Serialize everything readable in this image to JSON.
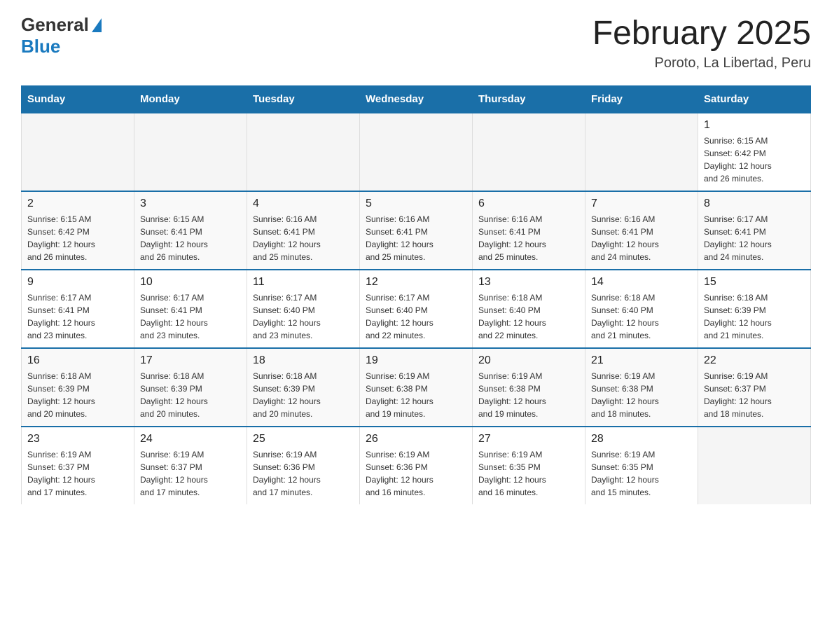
{
  "header": {
    "logo_general": "General",
    "logo_blue": "Blue",
    "month_title": "February 2025",
    "location": "Poroto, La Libertad, Peru"
  },
  "weekdays": [
    "Sunday",
    "Monday",
    "Tuesday",
    "Wednesday",
    "Thursday",
    "Friday",
    "Saturday"
  ],
  "weeks": [
    [
      {
        "day": "",
        "info": ""
      },
      {
        "day": "",
        "info": ""
      },
      {
        "day": "",
        "info": ""
      },
      {
        "day": "",
        "info": ""
      },
      {
        "day": "",
        "info": ""
      },
      {
        "day": "",
        "info": ""
      },
      {
        "day": "1",
        "info": "Sunrise: 6:15 AM\nSunset: 6:42 PM\nDaylight: 12 hours\nand 26 minutes."
      }
    ],
    [
      {
        "day": "2",
        "info": "Sunrise: 6:15 AM\nSunset: 6:42 PM\nDaylight: 12 hours\nand 26 minutes."
      },
      {
        "day": "3",
        "info": "Sunrise: 6:15 AM\nSunset: 6:41 PM\nDaylight: 12 hours\nand 26 minutes."
      },
      {
        "day": "4",
        "info": "Sunrise: 6:16 AM\nSunset: 6:41 PM\nDaylight: 12 hours\nand 25 minutes."
      },
      {
        "day": "5",
        "info": "Sunrise: 6:16 AM\nSunset: 6:41 PM\nDaylight: 12 hours\nand 25 minutes."
      },
      {
        "day": "6",
        "info": "Sunrise: 6:16 AM\nSunset: 6:41 PM\nDaylight: 12 hours\nand 25 minutes."
      },
      {
        "day": "7",
        "info": "Sunrise: 6:16 AM\nSunset: 6:41 PM\nDaylight: 12 hours\nand 24 minutes."
      },
      {
        "day": "8",
        "info": "Sunrise: 6:17 AM\nSunset: 6:41 PM\nDaylight: 12 hours\nand 24 minutes."
      }
    ],
    [
      {
        "day": "9",
        "info": "Sunrise: 6:17 AM\nSunset: 6:41 PM\nDaylight: 12 hours\nand 23 minutes."
      },
      {
        "day": "10",
        "info": "Sunrise: 6:17 AM\nSunset: 6:41 PM\nDaylight: 12 hours\nand 23 minutes."
      },
      {
        "day": "11",
        "info": "Sunrise: 6:17 AM\nSunset: 6:40 PM\nDaylight: 12 hours\nand 23 minutes."
      },
      {
        "day": "12",
        "info": "Sunrise: 6:17 AM\nSunset: 6:40 PM\nDaylight: 12 hours\nand 22 minutes."
      },
      {
        "day": "13",
        "info": "Sunrise: 6:18 AM\nSunset: 6:40 PM\nDaylight: 12 hours\nand 22 minutes."
      },
      {
        "day": "14",
        "info": "Sunrise: 6:18 AM\nSunset: 6:40 PM\nDaylight: 12 hours\nand 21 minutes."
      },
      {
        "day": "15",
        "info": "Sunrise: 6:18 AM\nSunset: 6:39 PM\nDaylight: 12 hours\nand 21 minutes."
      }
    ],
    [
      {
        "day": "16",
        "info": "Sunrise: 6:18 AM\nSunset: 6:39 PM\nDaylight: 12 hours\nand 20 minutes."
      },
      {
        "day": "17",
        "info": "Sunrise: 6:18 AM\nSunset: 6:39 PM\nDaylight: 12 hours\nand 20 minutes."
      },
      {
        "day": "18",
        "info": "Sunrise: 6:18 AM\nSunset: 6:39 PM\nDaylight: 12 hours\nand 20 minutes."
      },
      {
        "day": "19",
        "info": "Sunrise: 6:19 AM\nSunset: 6:38 PM\nDaylight: 12 hours\nand 19 minutes."
      },
      {
        "day": "20",
        "info": "Sunrise: 6:19 AM\nSunset: 6:38 PM\nDaylight: 12 hours\nand 19 minutes."
      },
      {
        "day": "21",
        "info": "Sunrise: 6:19 AM\nSunset: 6:38 PM\nDaylight: 12 hours\nand 18 minutes."
      },
      {
        "day": "22",
        "info": "Sunrise: 6:19 AM\nSunset: 6:37 PM\nDaylight: 12 hours\nand 18 minutes."
      }
    ],
    [
      {
        "day": "23",
        "info": "Sunrise: 6:19 AM\nSunset: 6:37 PM\nDaylight: 12 hours\nand 17 minutes."
      },
      {
        "day": "24",
        "info": "Sunrise: 6:19 AM\nSunset: 6:37 PM\nDaylight: 12 hours\nand 17 minutes."
      },
      {
        "day": "25",
        "info": "Sunrise: 6:19 AM\nSunset: 6:36 PM\nDaylight: 12 hours\nand 17 minutes."
      },
      {
        "day": "26",
        "info": "Sunrise: 6:19 AM\nSunset: 6:36 PM\nDaylight: 12 hours\nand 16 minutes."
      },
      {
        "day": "27",
        "info": "Sunrise: 6:19 AM\nSunset: 6:35 PM\nDaylight: 12 hours\nand 16 minutes."
      },
      {
        "day": "28",
        "info": "Sunrise: 6:19 AM\nSunset: 6:35 PM\nDaylight: 12 hours\nand 15 minutes."
      },
      {
        "day": "",
        "info": ""
      }
    ]
  ]
}
